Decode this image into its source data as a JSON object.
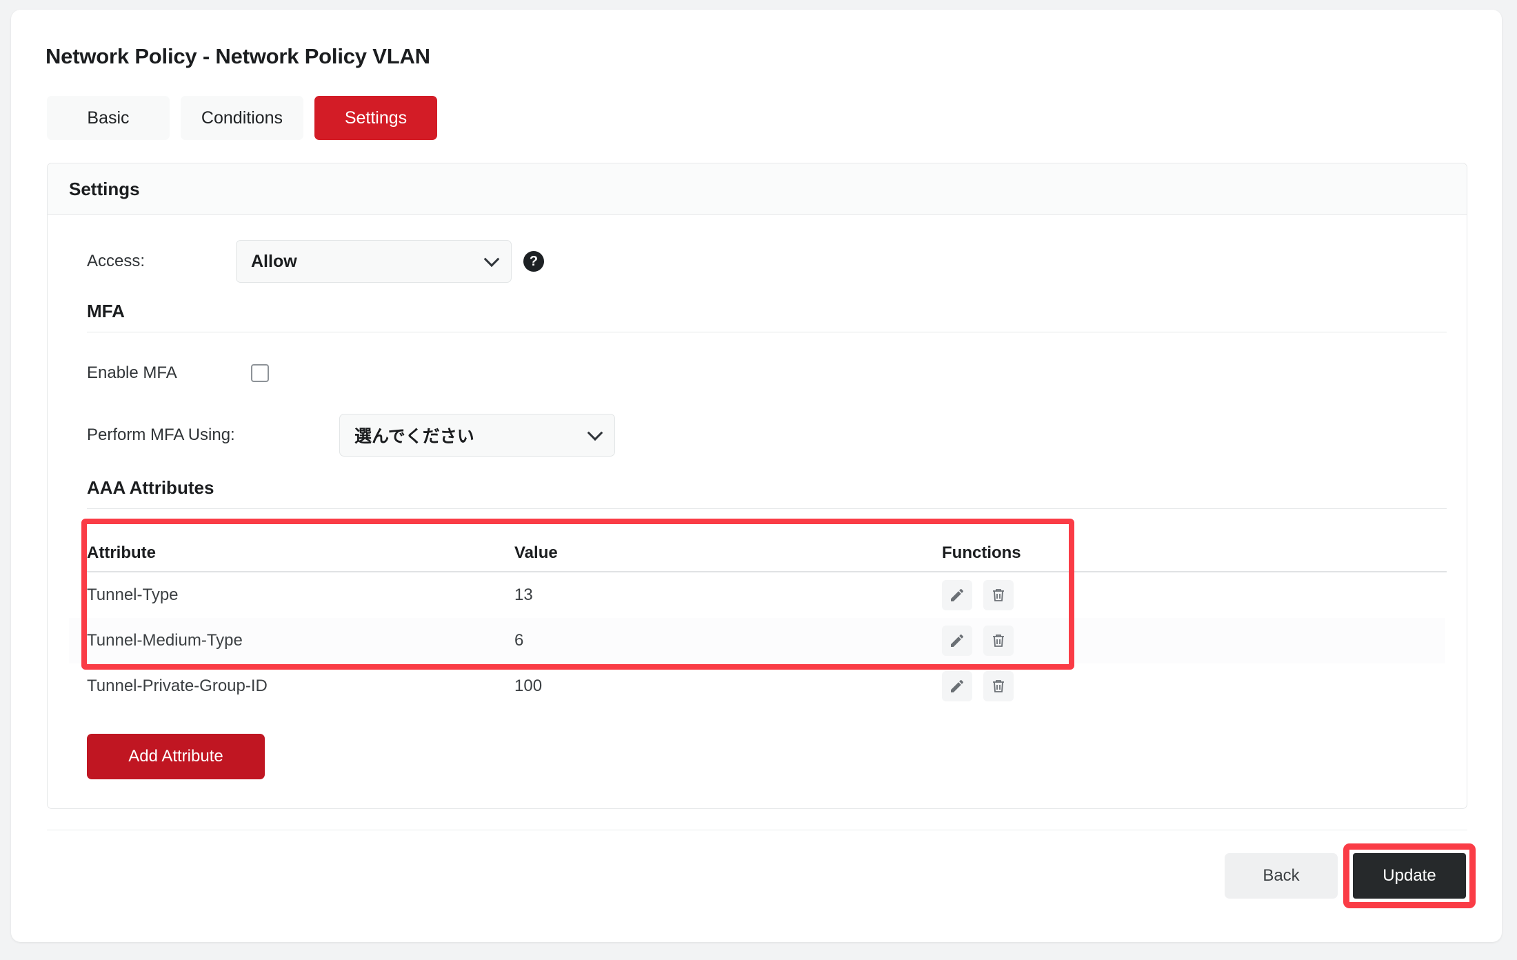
{
  "header": {
    "title": "Network Policy - Network Policy VLAN"
  },
  "tabs": [
    {
      "label": "Basic",
      "active": false
    },
    {
      "label": "Conditions",
      "active": false
    },
    {
      "label": "Settings",
      "active": true
    }
  ],
  "panel": {
    "title": "Settings",
    "access": {
      "label": "Access:",
      "value": "Allow",
      "help_icon": "question-mark-icon"
    },
    "mfa": {
      "heading": "MFA",
      "enable_label": "Enable MFA",
      "enable_checked": false,
      "perform_label": "Perform MFA Using:",
      "perform_value": "選んでください"
    },
    "aaa": {
      "heading": "AAA Attributes",
      "columns": [
        "Attribute",
        "Value",
        "Functions"
      ],
      "rows": [
        {
          "attribute": "Tunnel-Type",
          "value": "13",
          "edit_icon": "pencil-icon",
          "delete_icon": "trash-icon"
        },
        {
          "attribute": "Tunnel-Medium-Type",
          "value": "6",
          "edit_icon": "pencil-icon",
          "delete_icon": "trash-icon"
        },
        {
          "attribute": "Tunnel-Private-Group-ID",
          "value": "100",
          "edit_icon": "pencil-icon",
          "delete_icon": "trash-icon"
        }
      ],
      "add_button": "Add Attribute"
    }
  },
  "footer": {
    "back_label": "Back",
    "update_label": "Update"
  },
  "colors": {
    "brand_red": "#d31c26",
    "button_red": "#c01622",
    "annotation_red": "#fa3c46",
    "update_dark": "#26292b",
    "page_bg": "#f2f3f4"
  }
}
